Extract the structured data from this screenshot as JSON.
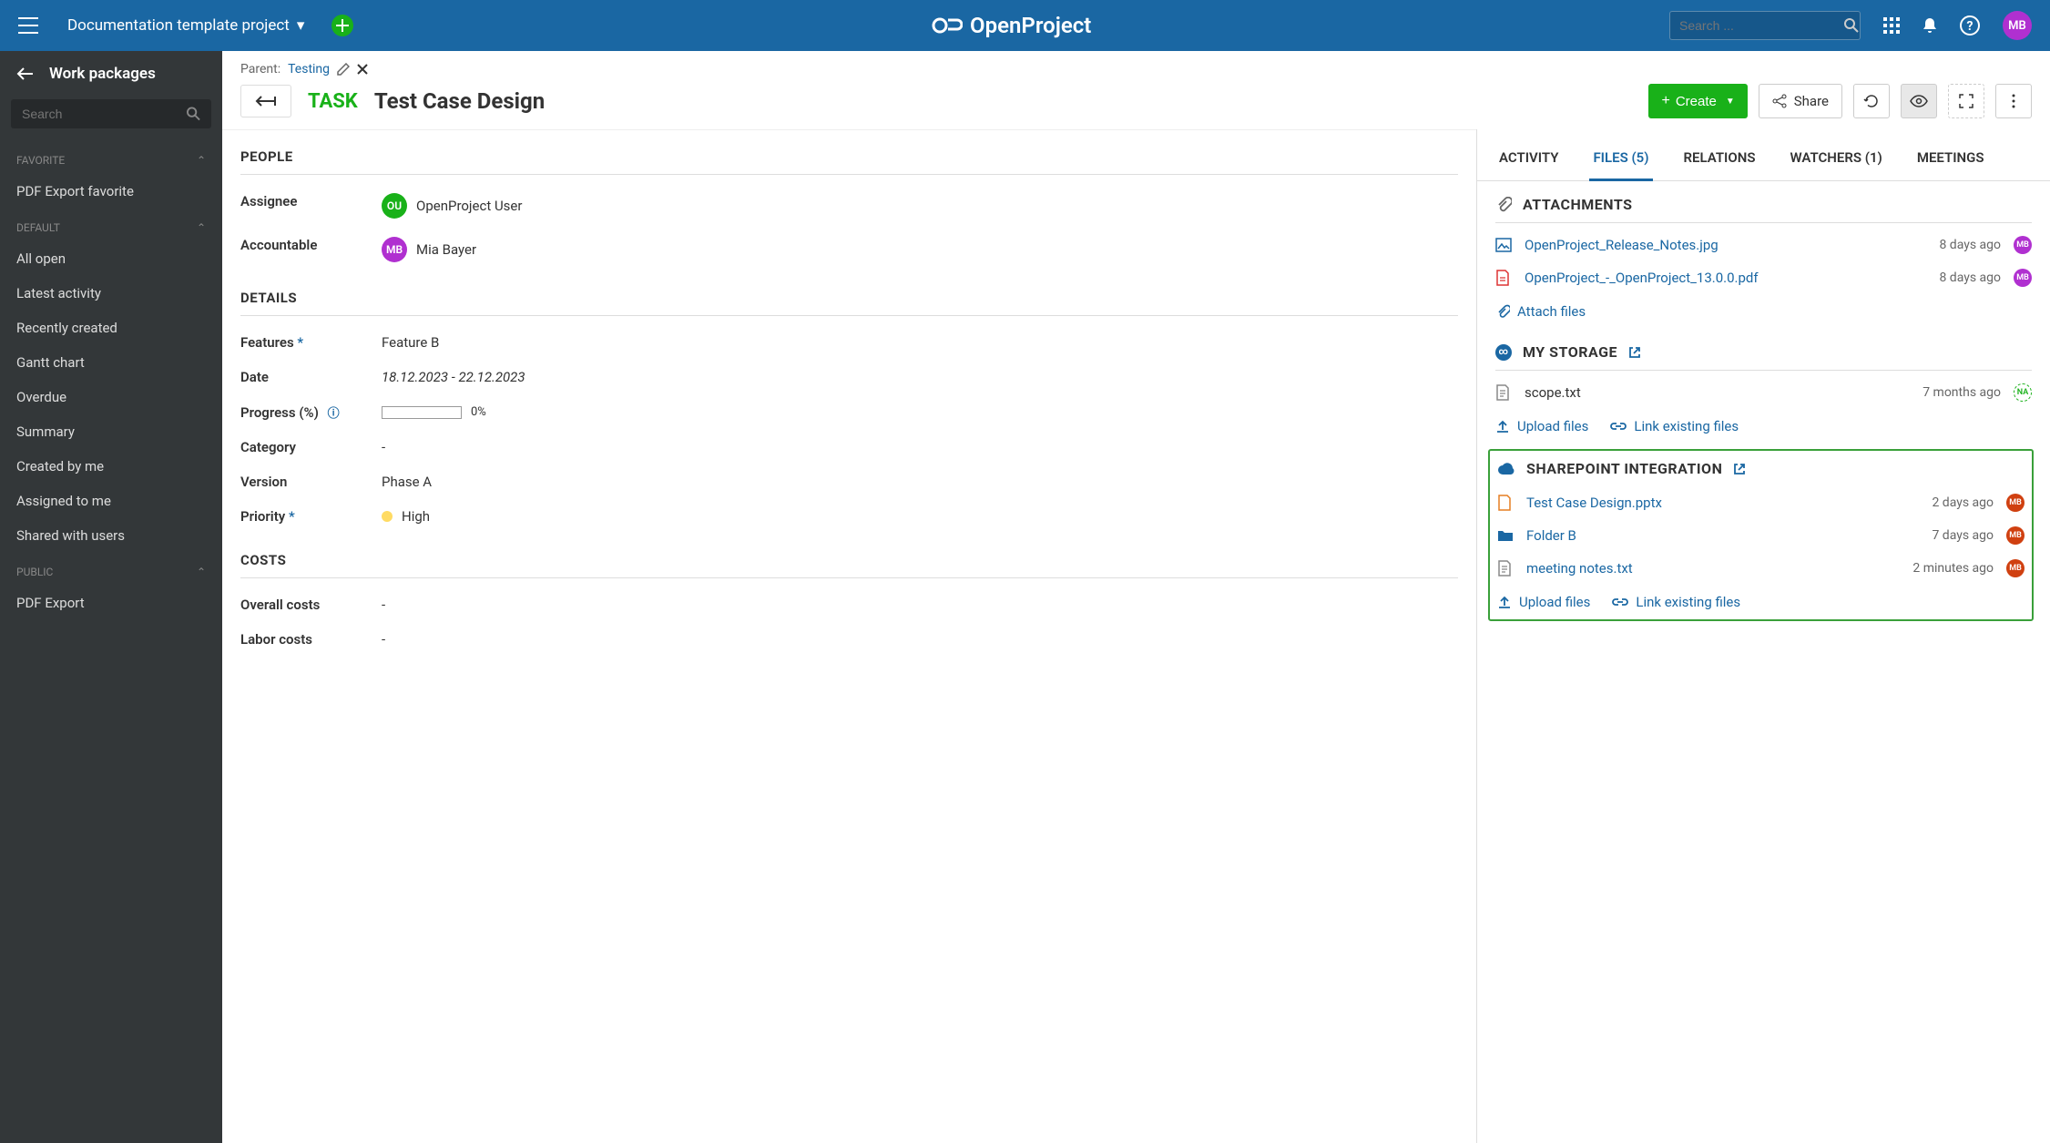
{
  "header": {
    "project_name": "Documentation template project",
    "search_placeholder": "Search ...",
    "user_initials": "MB",
    "logo_text": "OpenProject"
  },
  "sidebar": {
    "title": "Work packages",
    "search_placeholder": "Search",
    "sections": [
      {
        "label": "Favorite",
        "items": [
          "PDF Export favorite"
        ]
      },
      {
        "label": "Default",
        "items": [
          "All open",
          "Latest activity",
          "Recently created",
          "Gantt chart",
          "Overdue",
          "Summary",
          "Created by me",
          "Assigned to me",
          "Shared with users"
        ]
      },
      {
        "label": "Public",
        "items": [
          "PDF Export"
        ]
      }
    ]
  },
  "breadcrumb": {
    "parent_label": "Parent:",
    "parent_link": "Testing"
  },
  "wp": {
    "type": "Task",
    "title": "Test Case Design",
    "create_label": "Create",
    "share_label": "Share"
  },
  "people": {
    "heading": "People",
    "assignee_label": "Assignee",
    "assignee_initials": "OU",
    "assignee_name": "OpenProject User",
    "accountable_label": "Accountable",
    "accountable_initials": "MB",
    "accountable_name": "Mia Bayer"
  },
  "details": {
    "heading": "Details",
    "features_label": "Features",
    "features_value": "Feature B",
    "date_label": "Date",
    "date_value": "18.12.2023 - 22.12.2023",
    "progress_label": "Progress (%)",
    "progress_value": "0%",
    "category_label": "Category",
    "category_value": "-",
    "version_label": "Version",
    "version_value": "Phase A",
    "priority_label": "Priority",
    "priority_value": "High"
  },
  "costs": {
    "heading": "Costs",
    "overall_label": "Overall costs",
    "overall_value": "-",
    "labor_label": "Labor costs",
    "labor_value": "-"
  },
  "tabs": {
    "activity": "Activity",
    "files": "Files (5)",
    "relations": "Relations",
    "watchers": "Watchers (1)",
    "meetings": "Meetings"
  },
  "attachments": {
    "heading": "Attachments",
    "files": [
      {
        "name": "OpenProject_Release_Notes.jpg",
        "icon": "image",
        "time": "8 days ago",
        "avatar": "MB",
        "avatar_color": "purple"
      },
      {
        "name": "OpenProject_-_OpenProject_13.0.0.pdf",
        "icon": "pdf",
        "time": "8 days ago",
        "avatar": "MB",
        "avatar_color": "purple"
      }
    ],
    "attach_label": "Attach files"
  },
  "mystorage": {
    "heading": "My Storage",
    "files": [
      {
        "name": "scope.txt",
        "icon": "doc",
        "time": "7 months ago",
        "avatar": "NA",
        "avatar_outline": true
      }
    ],
    "upload_label": "Upload files",
    "link_label": "Link existing files"
  },
  "sharepoint": {
    "heading": "SharePoint Integration",
    "files": [
      {
        "name": "Test Case Design.pptx",
        "icon": "ppt",
        "time": "2 days ago",
        "avatar": "MB"
      },
      {
        "name": "Folder B",
        "icon": "folder",
        "time": "7 days ago",
        "avatar": "MB"
      },
      {
        "name": "meeting notes.txt",
        "icon": "doc",
        "time": "2 minutes ago",
        "avatar": "MB"
      }
    ],
    "upload_label": "Upload files",
    "link_label": "Link existing files"
  }
}
